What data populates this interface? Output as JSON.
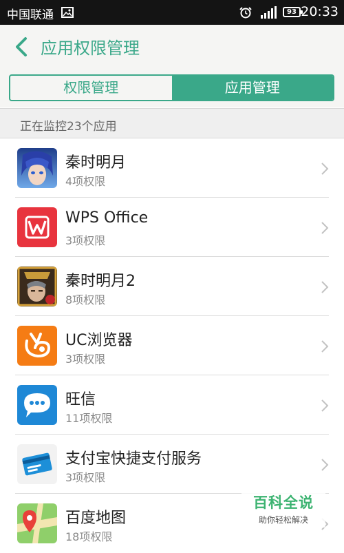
{
  "status_bar": {
    "carrier": "中国联通",
    "battery": "93",
    "time": "20:33",
    "icons": [
      "image-icon",
      "alarm-icon",
      "signal-icon",
      "battery-icon"
    ]
  },
  "header": {
    "title": "应用权限管理",
    "tabs": [
      {
        "label": "权限管理",
        "active": false
      },
      {
        "label": "应用管理",
        "active": true
      }
    ]
  },
  "section": {
    "text": "正在监控23个应用"
  },
  "apps": [
    {
      "name": "秦时明月",
      "perms": "4项权限",
      "icon": "qinshi-app-icon"
    },
    {
      "name": "WPS Office",
      "perms": "3项权限",
      "icon": "wps-app-icon"
    },
    {
      "name": "秦时明月2",
      "perms": "8项权限",
      "icon": "qinshi2-app-icon"
    },
    {
      "name": "UC浏览器",
      "perms": "3项权限",
      "icon": "uc-browser-app-icon"
    },
    {
      "name": "旺信",
      "perms": "11项权限",
      "icon": "wangxin-app-icon"
    },
    {
      "name": "支付宝快捷支付服务",
      "perms": "3项权限",
      "icon": "alipay-app-icon"
    },
    {
      "name": "百度地图",
      "perms": "18项权限",
      "icon": "baidu-map-app-icon"
    }
  ],
  "watermark": {
    "title": "百科全说",
    "subtitle": "助你轻松解决"
  },
  "colors": {
    "accent": "#3aa889",
    "status_bar": "#141414",
    "header_bg": "#f5f5f3"
  }
}
